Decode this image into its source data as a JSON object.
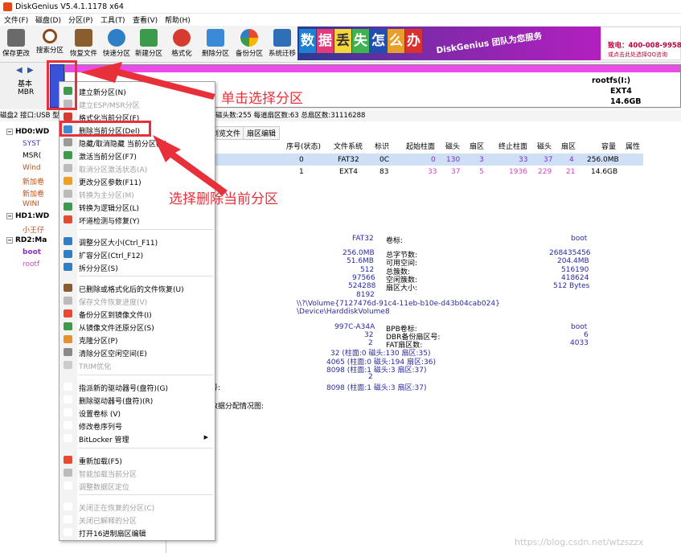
{
  "window": {
    "title": "DiskGenius V5.4.1.1178 x64"
  },
  "menubar": [
    "文件(F)",
    "磁盘(D)",
    "分区(P)",
    "工具(T)",
    "查看(V)",
    "帮助(H)"
  ],
  "toolbar": [
    "保存更改",
    "搜索分区",
    "恢复文件",
    "快速分区",
    "新建分区",
    "格式化",
    "删除分区",
    "备份分区",
    "系统迁移"
  ],
  "banner": {
    "chars": [
      "数",
      "据",
      "丢",
      "失",
      "怎",
      "么",
      "办"
    ],
    "slogan": "DiskGenius 团队为您服务",
    "phone": "致电：400-008-9958",
    "qq": "或点击此处选择QQ咨询"
  },
  "diskmap": {
    "type_label": "基本",
    "scheme_label": "MBR",
    "root_name": "rootfs(I:)",
    "root_fs": "EXT4",
    "root_size": "14.6GB"
  },
  "disk_info": "磁盘2 接口:USB  型号:...  204  容量:14.8GB(15193MB)  柱面数:1936  磁头数:255  每道扇区数:63  总扇区数:31116288",
  "tree": {
    "items": [
      "HD0:WD",
      "SYST",
      "MSR(",
      "Wind",
      "新加卷",
      "新加卷",
      "WINI",
      "HD1:WD",
      "小王仔",
      "RD2:Ma",
      "boot",
      "rootf"
    ]
  },
  "tabs": [
    "浏览文件",
    "扇区编辑"
  ],
  "grid": {
    "headers": [
      "序号(状态)",
      "文件系统",
      "标识",
      "起始柱面",
      "磁头",
      "扇区",
      "终止柱面",
      "磁头",
      "扇区",
      "容量",
      "属性"
    ],
    "rows": [
      [
        "0",
        "FAT32",
        "0C",
        "0",
        "130",
        "3",
        "33",
        "37",
        "4",
        "256.0MB",
        ""
      ],
      [
        "1",
        "EXT4",
        "83",
        "33",
        "37",
        "5",
        "1936",
        "229",
        "21",
        "14.6GB",
        ""
      ]
    ]
  },
  "details": {
    "fs": "FAT32",
    "vol_label_key": "卷标:",
    "vol_label_val": "boot",
    "left_vals": [
      "256.0MB",
      "51.6MB",
      "512",
      "97566",
      "524288",
      "8192"
    ],
    "mid_keys": [
      "总字节数:",
      "可用空间:",
      "总簇数:",
      "空闲簇数:",
      "扇区大小:"
    ],
    "right_vals": [
      "268435456",
      "204.4MB",
      "516190",
      "418624",
      "512 Bytes"
    ],
    "volume_guid": "\\\\?\\Volume{7127476d-91c4-11eb-b10e-d43b04cab024}",
    "device_path": "\\Device\\HarddiskVolume8",
    "serial": "997C-A34A",
    "bpb_key": "BPB卷标:",
    "bpb_val": "boot",
    "dbr_val": "32",
    "dbr_key": "DBR备份扇区号:",
    "dbr_num": "6",
    "fat_cnt": "2",
    "fat_key": "FAT扇区数:",
    "fat_num": "4033",
    "chs1": "32 (柱面:0 磁头:130 扇区:35)",
    "chs2": "4065 (柱面:0 磁头:194 扇区:36)",
    "chs3": "8098 (柱面:1 磁头:3 扇区:37)",
    "chs4_val": "2",
    "chs5": "8098 (柱面:1 磁头:3 扇区:37)",
    "tail_key": "号:",
    "alloc": "数据分配情况图:"
  },
  "context_menu": {
    "items": [
      {
        "label": "建立新分区(N)",
        "disabled": false
      },
      {
        "label": "建立ESP/MSR分区",
        "disabled": true
      },
      {
        "label": "格式化当前分区(F)",
        "disabled": false
      },
      {
        "label": "删除当前分区(Del)",
        "disabled": false
      },
      {
        "label": "隐藏/取消隐藏 当前分区(H)",
        "disabled": false
      },
      {
        "label": "激活当前分区(F7)",
        "disabled": false
      },
      {
        "label": "取消分区激活状态(A)",
        "disabled": true
      },
      {
        "label": "更改分区参数(F11)",
        "disabled": false
      },
      {
        "label": "转换为主分区(M)",
        "disabled": true
      },
      {
        "label": "转换为逻辑分区(L)",
        "disabled": false
      },
      {
        "label": "坏道检测与修复(Y)",
        "disabled": false
      },
      {
        "label": "调整分区大小(Ctrl_F11)",
        "disabled": false
      },
      {
        "label": "扩容分区(Ctrl_F12)",
        "disabled": false
      },
      {
        "label": "拆分分区(S)",
        "disabled": false
      },
      {
        "label": "已删除或格式化后的文件恢复(U)",
        "disabled": false
      },
      {
        "label": "保存文件恢复进度(V)",
        "disabled": true
      },
      {
        "label": "备份分区到镜像文件(I)",
        "disabled": false
      },
      {
        "label": "从镜像文件还原分区(S)",
        "disabled": false
      },
      {
        "label": "克隆分区(P)",
        "disabled": false
      },
      {
        "label": "清除分区空闲空间(E)",
        "disabled": false
      },
      {
        "label": "TRIM优化",
        "disabled": true
      },
      {
        "label": "指派新的驱动器号(盘符)(G)",
        "disabled": false
      },
      {
        "label": "删除驱动器号(盘符)(R)",
        "disabled": false
      },
      {
        "label": "设置卷标 (V)",
        "disabled": false
      },
      {
        "label": "修改卷序列号",
        "disabled": false
      },
      {
        "label": "BitLocker 管理",
        "disabled": false,
        "submenu": "▶"
      },
      {
        "label": "重新加载(F5)",
        "disabled": false
      },
      {
        "label": "智能加载当前分区",
        "disabled": true
      },
      {
        "label": "调整数据区定位",
        "disabled": true
      },
      {
        "label": "关闭正在恢复的分区(C)",
        "disabled": true
      },
      {
        "label": "关闭已解释的分区",
        "disabled": true
      },
      {
        "label": "打开16进制扇区编辑",
        "disabled": false
      }
    ]
  },
  "annotations": {
    "click_select": "单击选择分区",
    "choose_delete": "选择删除当前分区"
  },
  "watermark": "https://blog.csdn.net/wtzszzx",
  "colors": {
    "accent_red": "#e8303a",
    "partition_pink": "#ea4ce7",
    "partition_blue": "#3a52d8"
  }
}
